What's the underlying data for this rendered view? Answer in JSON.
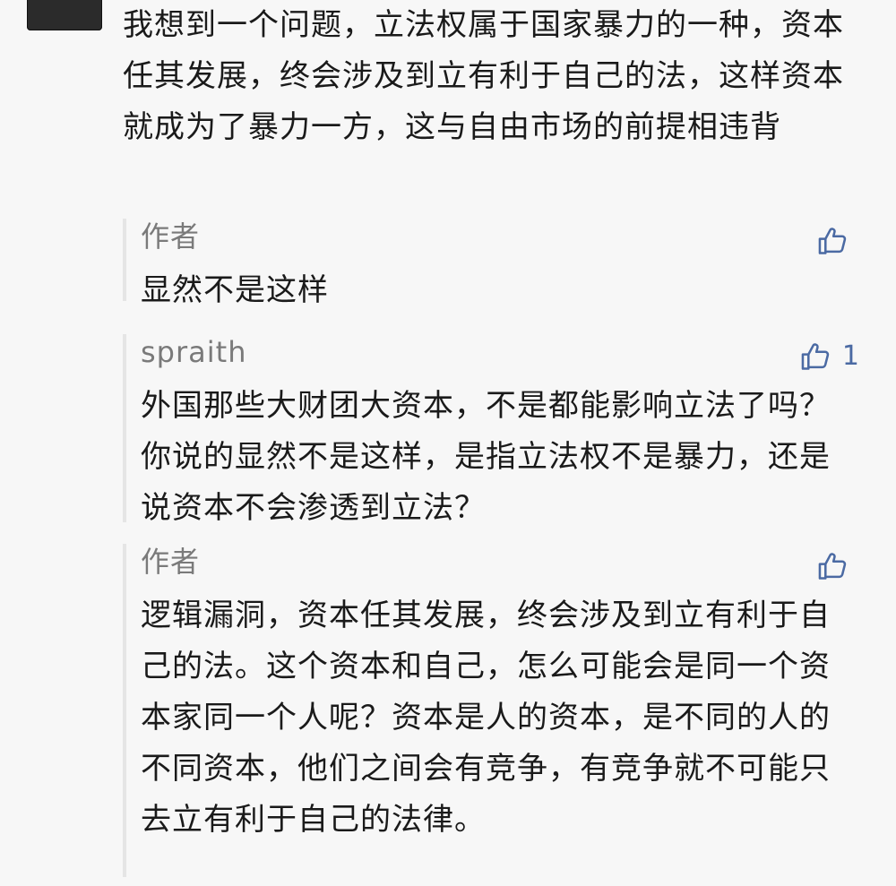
{
  "comment": {
    "text": "我想到一个问题，立法权属于国家暴力的一种，资本任其发展，终会涉及到立有利于自己的法，这样资本就成为了暴力一方，这与自由市场的前提相违背"
  },
  "replies": [
    {
      "author": "作者",
      "content": "显然不是这样",
      "like_count": ""
    },
    {
      "author": "spraith",
      "content": "外国那些大财团大资本，不是都能影响立法了吗？你说的显然不是这样，是指立法权不是暴力，还是说资本不会渗透到立法？",
      "like_count": "1"
    },
    {
      "author": "作者",
      "content": "逻辑漏洞，资本任其发展，终会涉及到立有利于自己的法。这个资本和自己，怎么可能会是同一个资本家同一个人呢？资本是人的资本，是不同的人的不同资本，他们之间会有竞争，有竞争就不可能只去立有利于自己的法律。",
      "like_count": ""
    }
  ],
  "colors": {
    "background": "#f7f7f7",
    "text": "#1a1a1a",
    "author": "#7a7a7a",
    "accent": "#4b6aa3",
    "quote_bar": "#e5e5e5"
  },
  "icons": {
    "like": "thumbs-up-icon",
    "avatar": "avatar"
  }
}
